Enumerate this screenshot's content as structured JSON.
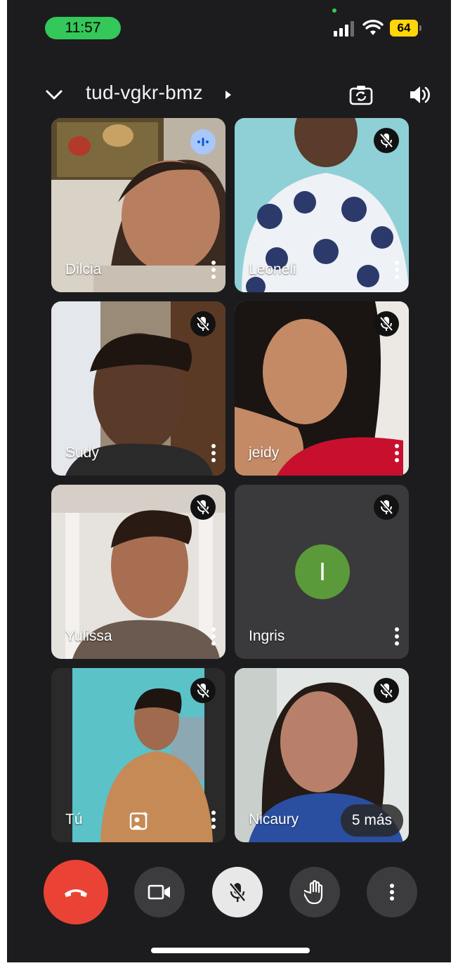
{
  "status_bar": {
    "time": "11:57",
    "battery": "64"
  },
  "header": {
    "meeting_code": "tud-vgkr-bmz"
  },
  "participants": [
    {
      "name": "Dilcia",
      "state": "speaking"
    },
    {
      "name": "Leoneli",
      "state": "muted"
    },
    {
      "name": "Sudy",
      "state": "muted"
    },
    {
      "name": "jeidy",
      "state": "muted"
    },
    {
      "name": "Yulissa",
      "state": "muted"
    },
    {
      "name": "Ingris",
      "state": "muted",
      "avatar_letter": "I",
      "avatar_color": "#5b9a3a"
    },
    {
      "name": "Tú",
      "state": "muted"
    },
    {
      "name": "Nicaury",
      "state": "muted"
    }
  ],
  "overflow": {
    "label": "5 más"
  },
  "controls": [
    "end-call",
    "camera",
    "microphone-muted",
    "raise-hand",
    "more-options"
  ],
  "colors": {
    "end_call": "#ea4335",
    "status_time": "#34c759",
    "battery": "#ffd60a",
    "speaking_badge": "#a8c7fa"
  }
}
